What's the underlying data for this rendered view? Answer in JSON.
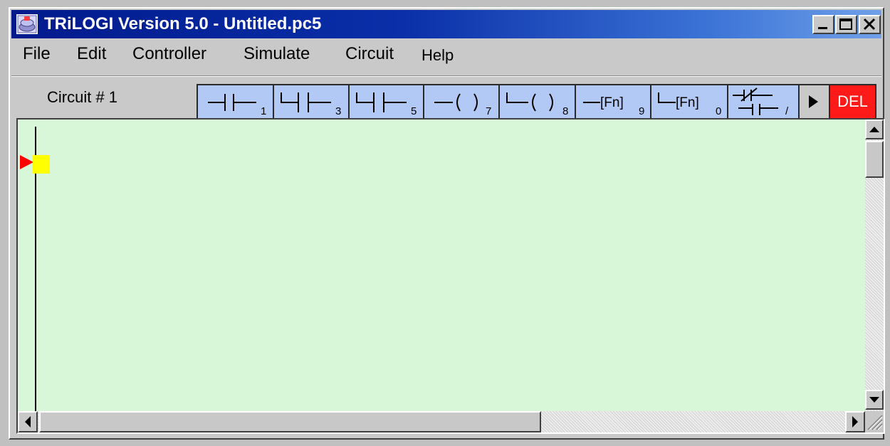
{
  "window": {
    "title": "TRiLOGI Version 5.0 - Untitled.pc5"
  },
  "menu": {
    "items": [
      "File",
      "Edit",
      "Controller",
      "Simulate",
      "Circuit",
      "Help"
    ]
  },
  "toolbar": {
    "circuit_label": "Circuit # 1",
    "buttons": [
      {
        "icon": "contact-series-icon",
        "key": "1"
      },
      {
        "icon": "contact-parallel-icon",
        "key": "3"
      },
      {
        "icon": "contact-branch-icon",
        "key": "5"
      },
      {
        "icon": "coil-icon",
        "key": "7"
      },
      {
        "icon": "coil-parallel-icon",
        "key": "8"
      },
      {
        "icon": "function-icon",
        "key": "9",
        "text": "[Fn]"
      },
      {
        "icon": "function-parallel-icon",
        "key": "0",
        "text": "[Fn]"
      },
      {
        "icon": "not-contact-icon",
        "key": "/"
      },
      {
        "icon": "play-icon"
      },
      {
        "label": "DEL"
      }
    ]
  },
  "colors": {
    "canvas_bg": "#d8f6d8",
    "toolbar_bg": "#b3c9f5",
    "delete_bg": "#ff1a1a",
    "cursor_box": "#ffff00",
    "cursor_arrow": "#ff0000"
  }
}
